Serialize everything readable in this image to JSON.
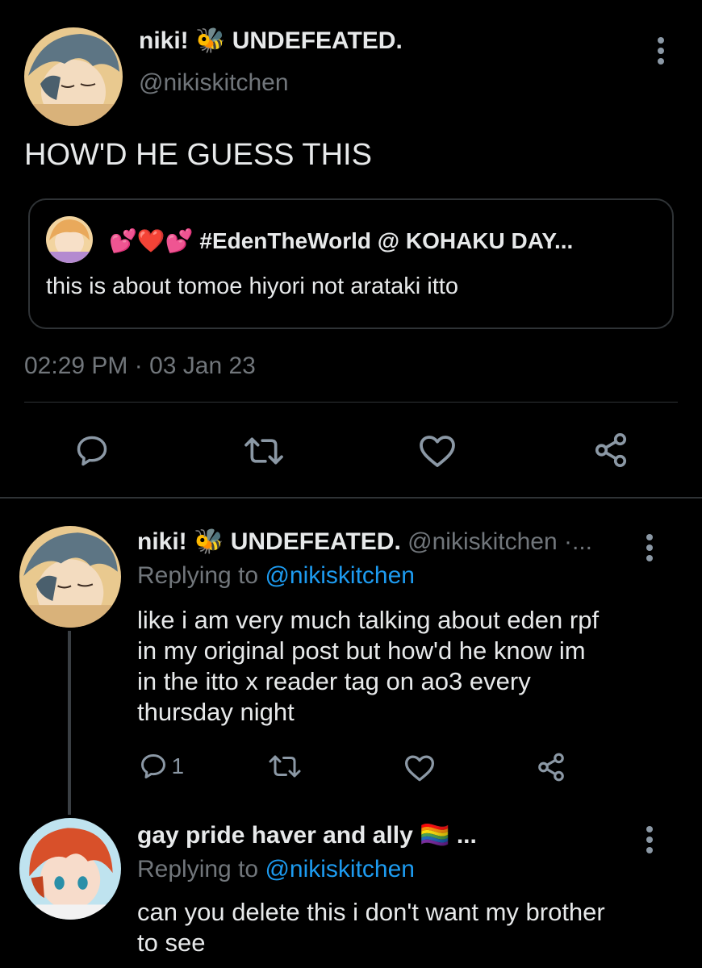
{
  "main_tweet": {
    "display_name": "niki! 🐝 UNDEFEATED.",
    "handle": "@nikiskitchen",
    "text": "HOW'D HE GUESS THIS",
    "timestamp": "02:29 PM · 03 Jan 23",
    "quoted": {
      "display_name": "💕❤️💕 #EdenTheWorld @ KOHAKU DAY...",
      "text": "this is about tomoe hiyori not arataki itto"
    }
  },
  "replies": [
    {
      "display_name": "niki! 🐝 UNDEFEATED.",
      "handle_time": "@nikiskitchen ·...",
      "replying_prefix": "Replying to",
      "replying_to": "@nikiskitchen",
      "text_lines": [
        "like i am very much talking about eden rpf",
        "in my original post but how'd he know im",
        "in the itto x reader tag on ao3 every",
        "thursday night"
      ],
      "reply_count": "1"
    },
    {
      "display_name": "gay pride haver and ally 🏳️‍🌈 ...",
      "replying_prefix": "Replying to",
      "replying_to": "@nikiskitchen",
      "text_lines": [
        "can you delete this i don't want my brother",
        "to see"
      ]
    }
  ],
  "colors": {
    "background": "#000000",
    "text": "#e7e9ea",
    "muted": "#71767b",
    "link": "#1d9bf0",
    "divider": "#2f3336"
  },
  "icons": [
    "reply-icon",
    "retweet-icon",
    "like-icon",
    "share-icon",
    "more-options-icon"
  ]
}
